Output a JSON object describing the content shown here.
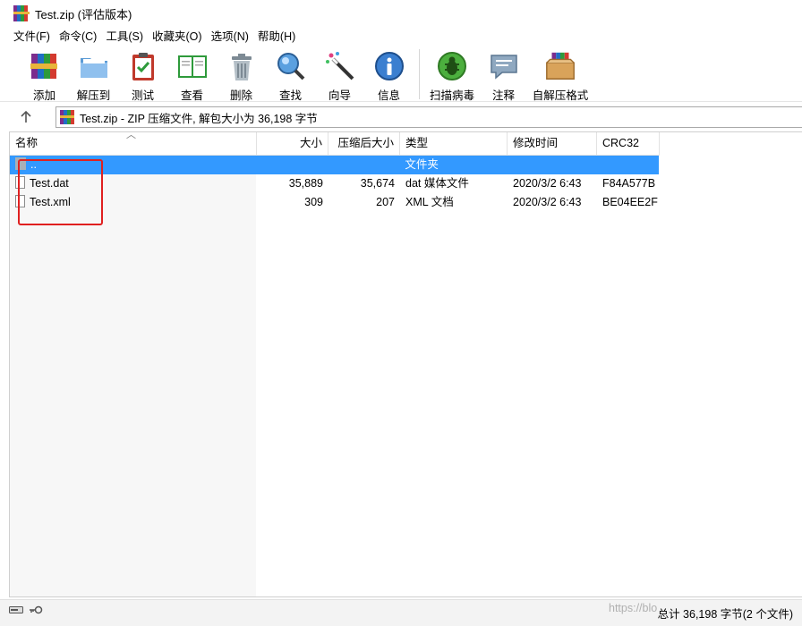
{
  "window": {
    "title": "Test.zip (评估版本)"
  },
  "menu": [
    "文件(F)",
    "命令(C)",
    "工具(S)",
    "收藏夹(O)",
    "选项(N)",
    "帮助(H)"
  ],
  "toolbar": {
    "add": "添加",
    "extract": "解压到",
    "test": "测试",
    "view": "查看",
    "delete": "删除",
    "find": "查找",
    "wizard": "向导",
    "info": "信息",
    "virus_scan": "扫描病毒",
    "comment": "注释",
    "sfx": "自解压格式"
  },
  "address": {
    "text": "Test.zip - ZIP 压缩文件, 解包大小为 36,198 字节"
  },
  "columns": {
    "name": "名称",
    "size": "大小",
    "packed": "压缩后大小",
    "type": "类型",
    "modified": "修改时间",
    "crc": "CRC32"
  },
  "files": [
    {
      "name": "..",
      "size": "",
      "packed": "",
      "type": "文件夹",
      "modified": "",
      "crc": ""
    },
    {
      "name": "Test.dat",
      "size": "35,889",
      "packed": "35,674",
      "type": "dat 媒体文件",
      "modified": "2020/3/2 6:43",
      "crc": "F84A577B"
    },
    {
      "name": "Test.xml",
      "size": "309",
      "packed": "207",
      "type": "XML 文档",
      "modified": "2020/3/2 6:43",
      "crc": "BE04EE2F"
    }
  ],
  "status": {
    "text": "总计 36,198 字节(2 个文件)"
  },
  "watermark": "https://blo"
}
